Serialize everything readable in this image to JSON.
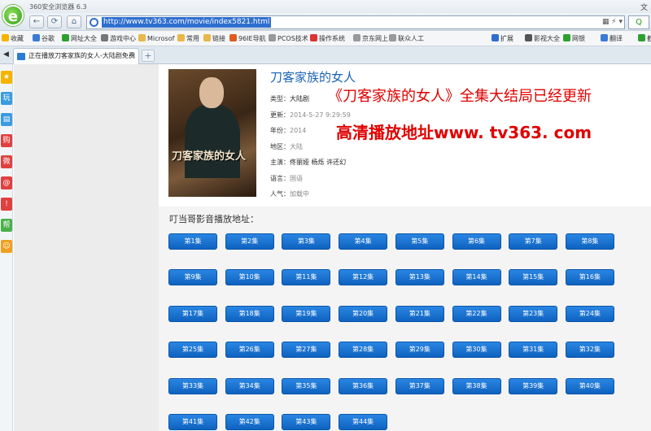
{
  "browser": {
    "title": "360安全浏览器 6.3",
    "title_right": "文",
    "url": "http://www.tv363.com/movie/index5821.html",
    "search_label": "Q",
    "addr_right": "▦ ⚡ ▾",
    "nav": {
      "back": "←",
      "forward": "→",
      "refresh": "⟳",
      "home": "⌂"
    },
    "bookmarks": [
      {
        "label": "收藏",
        "color": "#f5b400"
      },
      {
        "label": "谷歌",
        "color": "#3b7bd8"
      },
      {
        "label": "网址大全",
        "color": "#2ea02e"
      },
      {
        "label": "游戏中心",
        "color": "#777777"
      },
      {
        "label": "Microsof",
        "color": "#e8b84a"
      },
      {
        "label": "常用",
        "color": "#e8b84a"
      },
      {
        "label": "链接",
        "color": "#e8b84a"
      },
      {
        "label": "96IE导航",
        "color": "#e05a20"
      },
      {
        "label": "PCOS技术",
        "color": "#999999"
      },
      {
        "label": "操作系统",
        "color": "#d33"
      },
      {
        "label": "京东网上",
        "color": "#999999"
      },
      {
        "label": "联众人工",
        "color": "#999999"
      },
      {
        "label": "扩展",
        "color": "#2f6fd0"
      },
      {
        "label": "影视大全",
        "color": "#555555"
      },
      {
        "label": "网银",
        "color": "#2ea02e"
      },
      {
        "label": "翻译",
        "color": "#3b7bd8"
      },
      {
        "label": "截",
        "color": "#2ea02e"
      }
    ],
    "tab_title": "正在播放刀客家族的女人-大陆剧免费",
    "tab_close": "×",
    "new_tab": "+",
    "sidebar_toggle": "◀",
    "rail_icons": [
      {
        "label": "★",
        "color": "#f5b400"
      },
      {
        "label": "玩",
        "color": "#3b9be0"
      },
      {
        "label": "▤",
        "color": "#3b9be0"
      },
      {
        "label": "购",
        "color": "#e04040"
      },
      {
        "label": "微",
        "color": "#e04040"
      },
      {
        "label": "@",
        "color": "#e04040"
      },
      {
        "label": "!",
        "color": "#e04040"
      },
      {
        "label": "帮",
        "color": "#4ab04a"
      },
      {
        "label": "☺",
        "color": "#f0a020"
      }
    ]
  },
  "movie": {
    "title": "刀客家族的女人",
    "fields": [
      {
        "label": "类型：",
        "value": "大陆剧",
        "dark": true
      },
      {
        "label": "更新：",
        "value": "2014-5-27 9:29:59",
        "dark": false
      },
      {
        "label": "年份：",
        "value": "2014",
        "dark": false
      },
      {
        "label": "地区：",
        "value": "大陆",
        "dark": false
      },
      {
        "label": "主演：",
        "value": "佟丽娅  杨烁  许还幻",
        "dark": true
      },
      {
        "label": "语言：",
        "value": "国语",
        "dark": false
      },
      {
        "label": "人气：",
        "value": "加载中",
        "dark": false
      }
    ],
    "promo_line1": "《刀客家族的女人》全集大结局已经更新",
    "promo_line2": "高清播放地址www. tv363. com",
    "poster_text": "刀客家族的女人"
  },
  "playlist": {
    "heading": "叮当哥影音播放地址：",
    "episodes": [
      "第1集",
      "第2集",
      "第3集",
      "第4集",
      "第5集",
      "第6集",
      "第7集",
      "第8集",
      "第9集",
      "第10集",
      "第11集",
      "第12集",
      "第13集",
      "第14集",
      "第15集",
      "第16集",
      "第17集",
      "第18集",
      "第19集",
      "第20集",
      "第21集",
      "第22集",
      "第23集",
      "第24集",
      "第25集",
      "第26集",
      "第27集",
      "第28集",
      "第29集",
      "第30集",
      "第31集",
      "第32集",
      "第33集",
      "第34集",
      "第35集",
      "第36集",
      "第37集",
      "第38集",
      "第39集",
      "第40集",
      "第41集",
      "第42集",
      "第43集",
      "第44集"
    ]
  }
}
